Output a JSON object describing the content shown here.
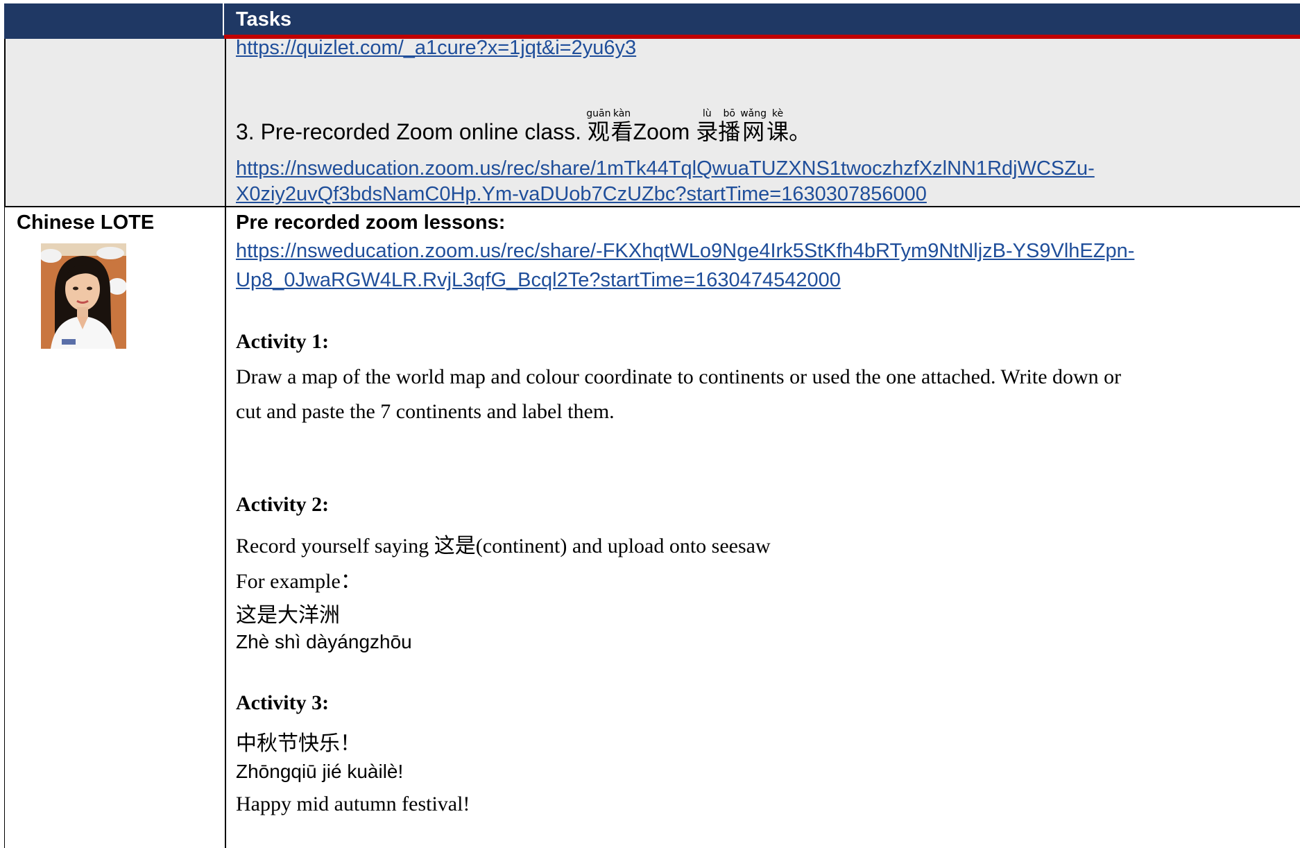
{
  "header": {
    "title": "Tasks"
  },
  "row1": {
    "link1": "https://quizlet.com/_a1cure?x=1jqt&i=2yu6y3",
    "item3_prefix": "3. Pre-recorded Zoom online class. ",
    "item3_chars": [
      {
        "c": "观",
        "py": "guān"
      },
      {
        "c": "看",
        "py": "kàn"
      }
    ],
    "item3_mid": "Zoom ",
    "item3_chars2": [
      {
        "c": "录",
        "py": "lù"
      },
      {
        "c": "播",
        "py": "bō"
      },
      {
        "c": "网",
        "py": "wǎng"
      },
      {
        "c": "课",
        "py": "kè"
      }
    ],
    "item3_end": "。",
    "link2_line1": "https://nsweducation.zoom.us/rec/share/1mTk44TqlQwuaTUZXNS1twoczhzfXzlNN1RdjWCSZu-",
    "link2_line2": "X0ziy2uvQf3bdsNamC0Hp.Ym-vaDUob7CzUZbc?startTime=1630307856000"
  },
  "row2": {
    "subject": "Chinese LOTE",
    "heading": "Pre recorded zoom lessons:",
    "link_line1": "https://nsweducation.zoom.us/rec/share/-FKXhqtWLo9Nge4Irk5StKfh4bRTym9NtNljzB-YS9VlhEZpn-",
    "link_line2": "Up8_0JwaRGW4LR.RvjL3qfG_Bcql2Te?startTime=1630474542000",
    "activity1_title": "Activity 1:",
    "activity1_line1": "Draw a map of the world map and colour coordinate to continents or used the one attached. Write down or",
    "activity1_line2": "cut and paste the 7 continents and label them.",
    "activity2_title": "Activity 2:",
    "activity2_line1": "Record yourself saying 这是(continent) and upload onto seesaw",
    "activity2_line2": "For example：",
    "activity2_line3": "这是大洋洲",
    "activity2_line4": "Zhè shì dàyángzhōu",
    "activity3_title": "Activity 3:",
    "activity3_line1": "中秋节快乐！",
    "activity3_line2": "Zhōngqiū jié kuàilè!",
    "activity3_line3": "Happy mid autumn festival!"
  }
}
